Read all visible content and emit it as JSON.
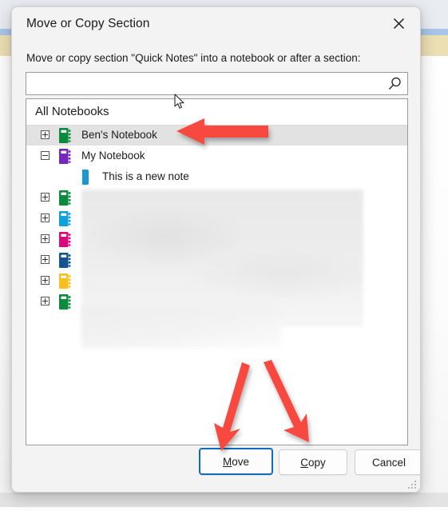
{
  "dialog": {
    "title": "Move or Copy Section",
    "close_icon": "close-icon",
    "instruction": "Move or copy section \"Quick Notes\" into a notebook or after a section:"
  },
  "search": {
    "value": "",
    "placeholder": "",
    "icon": "search-icon"
  },
  "list": {
    "header": "All Notebooks",
    "items": [
      {
        "label": "Ben's Notebook",
        "icon": "notebook-icon",
        "color": "#0e8a3e",
        "expander": "plus",
        "indent": 0,
        "selected": true,
        "blurred": false
      },
      {
        "label": "My Notebook",
        "icon": "notebook-icon",
        "color": "#7428ba",
        "expander": "minus",
        "indent": 0,
        "selected": false,
        "blurred": false
      },
      {
        "label": "This is a new note",
        "icon": "section-icon",
        "color": "#1c96d4",
        "expander": "none",
        "indent": 1,
        "selected": false,
        "blurred": false
      },
      {
        "label": "",
        "icon": "notebook-icon",
        "color": "#0e8a3e",
        "expander": "plus",
        "indent": 0,
        "selected": false,
        "blurred": true
      },
      {
        "label": "",
        "icon": "notebook-icon",
        "color": "#12a0dd",
        "expander": "plus",
        "indent": 0,
        "selected": false,
        "blurred": true
      },
      {
        "label": "",
        "icon": "notebook-icon",
        "color": "#d60a7e",
        "expander": "plus",
        "indent": 0,
        "selected": false,
        "blurred": true
      },
      {
        "label": "",
        "icon": "notebook-icon",
        "color": "#14538f",
        "expander": "plus",
        "indent": 0,
        "selected": false,
        "blurred": true
      },
      {
        "label": "",
        "icon": "notebook-icon",
        "color": "#f9bf1c",
        "expander": "plus",
        "indent": 0,
        "selected": false,
        "blurred": true
      },
      {
        "label": "",
        "icon": "notebook-icon",
        "color": "#0e8a3e",
        "expander": "plus",
        "indent": 0,
        "selected": false,
        "blurred": true
      }
    ]
  },
  "buttons": {
    "move": {
      "label": "Move",
      "accel": "M",
      "default": true
    },
    "copy": {
      "label": "Copy",
      "accel": "C",
      "default": false
    },
    "cancel": {
      "label": "Cancel",
      "accel": "",
      "default": false
    }
  },
  "annotations": {
    "color": "#f74a40",
    "arrows": [
      {
        "name": "arrow-to-bens-notebook",
        "direction": "left"
      },
      {
        "name": "arrow-to-move-button",
        "direction": "down-left"
      },
      {
        "name": "arrow-to-copy-button",
        "direction": "down-right"
      }
    ]
  },
  "cursor": {
    "type": "arrow-pointer"
  },
  "colors": {
    "accent": "#0f6cbd",
    "selection": "#e2e2e2",
    "annotation_red": "#f74a40",
    "backdrop_blue": "#a8c6e8",
    "backdrop_tan": "#ecdfb4"
  }
}
